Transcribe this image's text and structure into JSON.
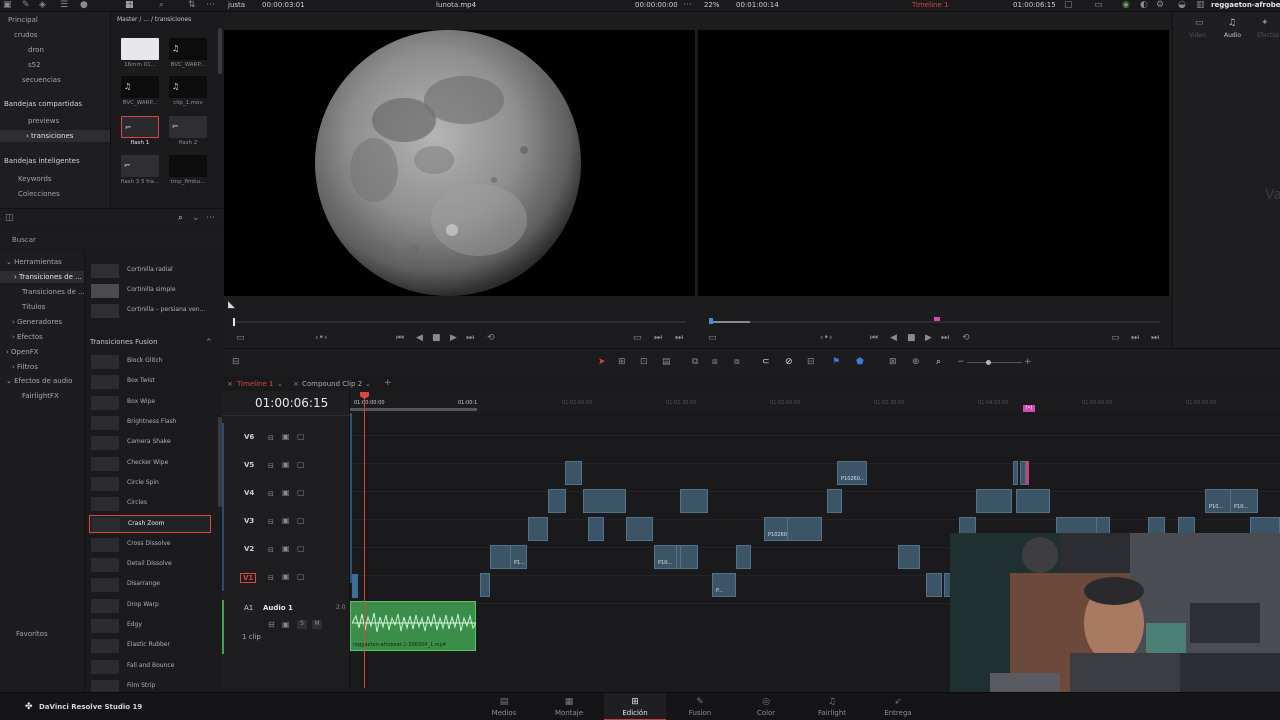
{
  "topbar": {
    "zoom_label": "justa",
    "src_timecode": "00:00:03:01",
    "clip_name": "lunota.mp4",
    "src_duration": "00:00:00:00",
    "tl_zoom": "22%",
    "tl_duration": "00:01:00:14",
    "timeline_name": "Timeline 1",
    "tl_timecode": "01:00:06:15",
    "project_name": "reggaeton-afrobeat"
  },
  "breadcrumb": "Master / ... / transiciones",
  "bins": {
    "principal": "Principal",
    "crudos": "crudos",
    "dron": "dron",
    "s52": "s52",
    "secuencias": "secuencias",
    "shared_head": "Bandejas compartidas",
    "previews": "previews",
    "transiciones": "transiciones",
    "smart_head": "Bandejas inteligentes",
    "keywords": "Keywords",
    "colecciones": "Colecciones"
  },
  "media": [
    {
      "label": "16mm 01...",
      "style": "white"
    },
    {
      "label": "BVC_WARP...",
      "style": "audio"
    },
    {
      "label": "BVC_WARP...",
      "style": "audio"
    },
    {
      "label": "clip_1.mov",
      "style": "audio"
    },
    {
      "label": "flash 1",
      "style": "selected"
    },
    {
      "label": "flash 2",
      "style": "gray"
    },
    {
      "label": "flash 3 5 fra...",
      "style": "gray"
    },
    {
      "label": "tmp_flmbu...",
      "style": "dark"
    }
  ],
  "search": {
    "placeholder": "Buscar"
  },
  "tree": {
    "herramientas": "Herramientas",
    "trans1": "Transiciones de ...",
    "trans2": "Transiciones de ...",
    "titulos": "Títulos",
    "generadores": "Generadores",
    "efectos": "Efectos",
    "openfx": "OpenFX",
    "filtros": "Filtros",
    "efectos_audio": "Efectos de audio",
    "fairlightfx": "FairlightFX",
    "favoritos": "Favoritos"
  },
  "fx_top": [
    "Cortinilla radial",
    "Cortinilla simple",
    "Cortinilla – persiana ven..."
  ],
  "fusion_head": "Transiciones Fusion",
  "fusion_list": [
    "Block Glitch",
    "Box Twist",
    "Box Wipe",
    "Brightness Flash",
    "Camera Shake",
    "Checker Wipe",
    "Circle Spin",
    "Circles",
    "Crash Zoom",
    "Cross Dissolve",
    "Detail Dissolve",
    "Disarrange",
    "Drop Warp",
    "Edgy",
    "Elastic Rubber",
    "Fall and Bounce",
    "Film Strip"
  ],
  "timeline": {
    "tabs": [
      "Timeline 1",
      "Compound Clip 2"
    ],
    "timecode": "01:00:06:15",
    "ruler": [
      "01:00:00:00",
      "01:00:1",
      "01:01:00:00",
      "01:01:30:00",
      "01:02:00:00",
      "01:02:30:00",
      "01:04:10:00",
      "01:05:00:00",
      "01:05:50:00",
      "01:06:40:00"
    ],
    "tracks": [
      "V6",
      "V5",
      "V4",
      "V3",
      "V2",
      "V1"
    ],
    "audio_id": "A1",
    "audio_name": "Audio 1",
    "audio_level": "2.0",
    "audio_clips": "1 clip",
    "audio_clip_name": "reggaeton-afrobeat-1-296504_1.mp4",
    "clip_labels": [
      "P10260...",
      "P10260...",
      "P1...",
      "P10...",
      "P1...",
      "P...",
      "P...",
      "P...",
      "P10...",
      "P10..."
    ]
  },
  "inspector": {
    "tabs": [
      "Video",
      "Audio",
      "Efectos"
    ],
    "partial": "Va"
  },
  "pages": [
    "Medios",
    "Montaje",
    "Edición",
    "Fusion",
    "Color",
    "Fairlight",
    "Entrega"
  ],
  "app_name": "DaVinci Resolve Studio 19",
  "colors": {
    "accent": "#e0443d",
    "clip": "#3a5568",
    "audio": "#3da34f",
    "page_active": "#d43c3c"
  }
}
